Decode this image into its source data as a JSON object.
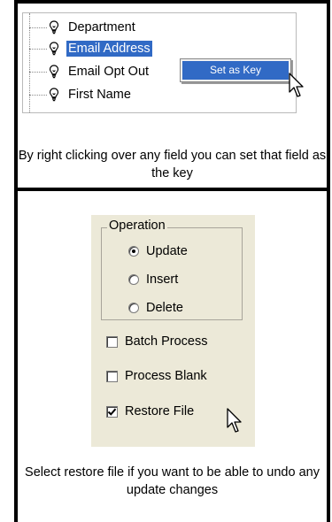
{
  "tree": {
    "items": [
      {
        "label": "Department",
        "selected": false
      },
      {
        "label": "Email Address",
        "selected": true
      },
      {
        "label": "Email Opt Out",
        "selected": false
      },
      {
        "label": "First Name",
        "selected": false
      }
    ]
  },
  "context_menu": {
    "items": [
      {
        "label": "Set as Key"
      }
    ]
  },
  "captions": {
    "top": "By right clicking over any field you can set that field as the key",
    "bottom": "Select restore file if you want to be able to undo any update changes"
  },
  "operation": {
    "title": "Operation",
    "options": [
      {
        "label": "Update",
        "selected": true
      },
      {
        "label": "Insert",
        "selected": false
      },
      {
        "label": "Delete",
        "selected": false
      }
    ]
  },
  "checkboxes": [
    {
      "label": "Batch Process",
      "checked": false
    },
    {
      "label": "Process Blank",
      "checked": false
    },
    {
      "label": "Restore File",
      "checked": true
    }
  ],
  "colors": {
    "selection": "#316ac5",
    "panel_bg": "#ece9d8"
  },
  "icons": {
    "tree_item": "lightbulb-key-icon",
    "cursor": "arrow-pointer-icon"
  }
}
